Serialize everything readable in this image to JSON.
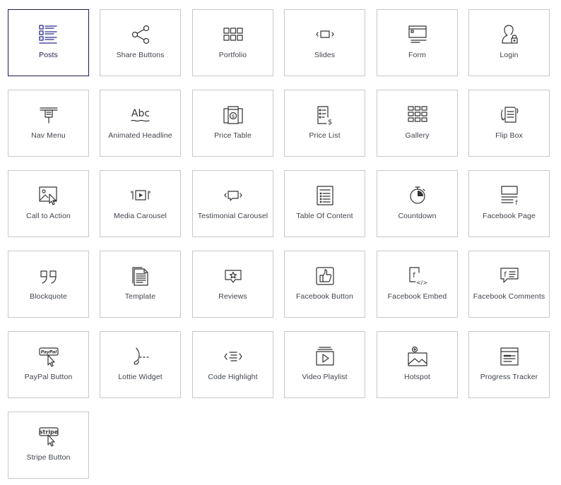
{
  "widgets": [
    {
      "label": "Posts",
      "icon": "posts-icon",
      "selected": true
    },
    {
      "label": "Share Buttons",
      "icon": "share-icon"
    },
    {
      "label": "Portfolio",
      "icon": "portfolio-icon"
    },
    {
      "label": "Slides",
      "icon": "slides-icon"
    },
    {
      "label": "Form",
      "icon": "form-icon"
    },
    {
      "label": "Login",
      "icon": "login-icon"
    },
    {
      "label": "Nav Menu",
      "icon": "nav-menu-icon"
    },
    {
      "label": "Animated Headline",
      "icon": "animated-headline-icon",
      "icon_text": "Abc"
    },
    {
      "label": "Price Table",
      "icon": "price-table-icon"
    },
    {
      "label": "Price List",
      "icon": "price-list-icon"
    },
    {
      "label": "Gallery",
      "icon": "gallery-icon"
    },
    {
      "label": "Flip Box",
      "icon": "flip-box-icon"
    },
    {
      "label": "Call to Action",
      "icon": "call-to-action-icon"
    },
    {
      "label": "Media Carousel",
      "icon": "media-carousel-icon"
    },
    {
      "label": "Testimonial Carousel",
      "icon": "testimonial-carousel-icon"
    },
    {
      "label": "Table Of Content",
      "icon": "table-of-content-icon"
    },
    {
      "label": "Countdown",
      "icon": "countdown-icon"
    },
    {
      "label": "Facebook Page",
      "icon": "facebook-page-icon"
    },
    {
      "label": "Blockquote",
      "icon": "blockquote-icon"
    },
    {
      "label": "Template",
      "icon": "template-icon"
    },
    {
      "label": "Reviews",
      "icon": "reviews-icon"
    },
    {
      "label": "Facebook Button",
      "icon": "facebook-button-icon"
    },
    {
      "label": "Facebook Embed",
      "icon": "facebook-embed-icon"
    },
    {
      "label": "Facebook Comments",
      "icon": "facebook-comments-icon"
    },
    {
      "label": "PayPal Button",
      "icon": "paypal-button-icon",
      "icon_text": "PayPal"
    },
    {
      "label": "Lottie Widget",
      "icon": "lottie-widget-icon"
    },
    {
      "label": "Code Highlight",
      "icon": "code-highlight-icon"
    },
    {
      "label": "Video Playlist",
      "icon": "video-playlist-icon"
    },
    {
      "label": "Hotspot",
      "icon": "hotspot-icon"
    },
    {
      "label": "Progress Tracker",
      "icon": "progress-tracker-icon"
    },
    {
      "label": "Stripe Button",
      "icon": "stripe-button-icon",
      "icon_text": "stripe"
    }
  ],
  "colors": {
    "tile_border": "#c8c8c8",
    "selected_border": "#1c1c4a",
    "selected_icon": "#2a2a8a",
    "icon_stroke": "#333333",
    "label_text": "#3f444b"
  }
}
